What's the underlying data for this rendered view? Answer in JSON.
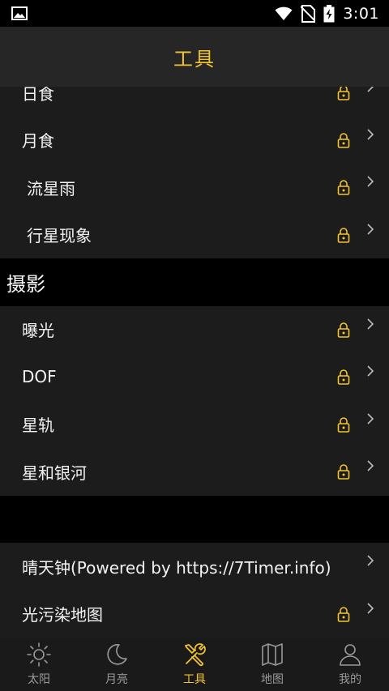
{
  "status_bar": {
    "time": "3:01",
    "icons": [
      "image-icon",
      "wifi-icon",
      "no-sim-icon",
      "battery-charging-icon"
    ]
  },
  "header": {
    "title": "工具"
  },
  "sections": {
    "events_group": {
      "items": [
        {
          "label": "日食",
          "locked": true
        },
        {
          "label": "月食",
          "locked": true
        },
        {
          "label": "流星雨",
          "locked": true
        },
        {
          "label": "行星现象",
          "locked": true
        }
      ]
    },
    "photography": {
      "title": "摄影",
      "items": [
        {
          "label": "曝光",
          "locked": true
        },
        {
          "label": "DOF",
          "locked": true
        },
        {
          "label": "星轨",
          "locked": true
        },
        {
          "label": "星和银河",
          "locked": true
        }
      ]
    },
    "other": {
      "items": [
        {
          "label": "晴天钟(Powered by https://7Timer.info)",
          "locked": false
        },
        {
          "label": "光污染地图",
          "locked": true
        }
      ]
    }
  },
  "tab_bar": {
    "tabs": [
      {
        "label": "太阳",
        "icon": "sun-icon",
        "active": false
      },
      {
        "label": "月亮",
        "icon": "moon-icon",
        "active": false
      },
      {
        "label": "工具",
        "icon": "tools-icon",
        "active": true
      },
      {
        "label": "地图",
        "icon": "map-icon",
        "active": false
      },
      {
        "label": "我的",
        "icon": "profile-icon",
        "active": false
      }
    ]
  },
  "colors": {
    "accent": "#f4c430",
    "background": "#000000",
    "row_background": "#1c1c1c",
    "header_background": "#262626",
    "inactive_tab": "#9a9a9a"
  }
}
